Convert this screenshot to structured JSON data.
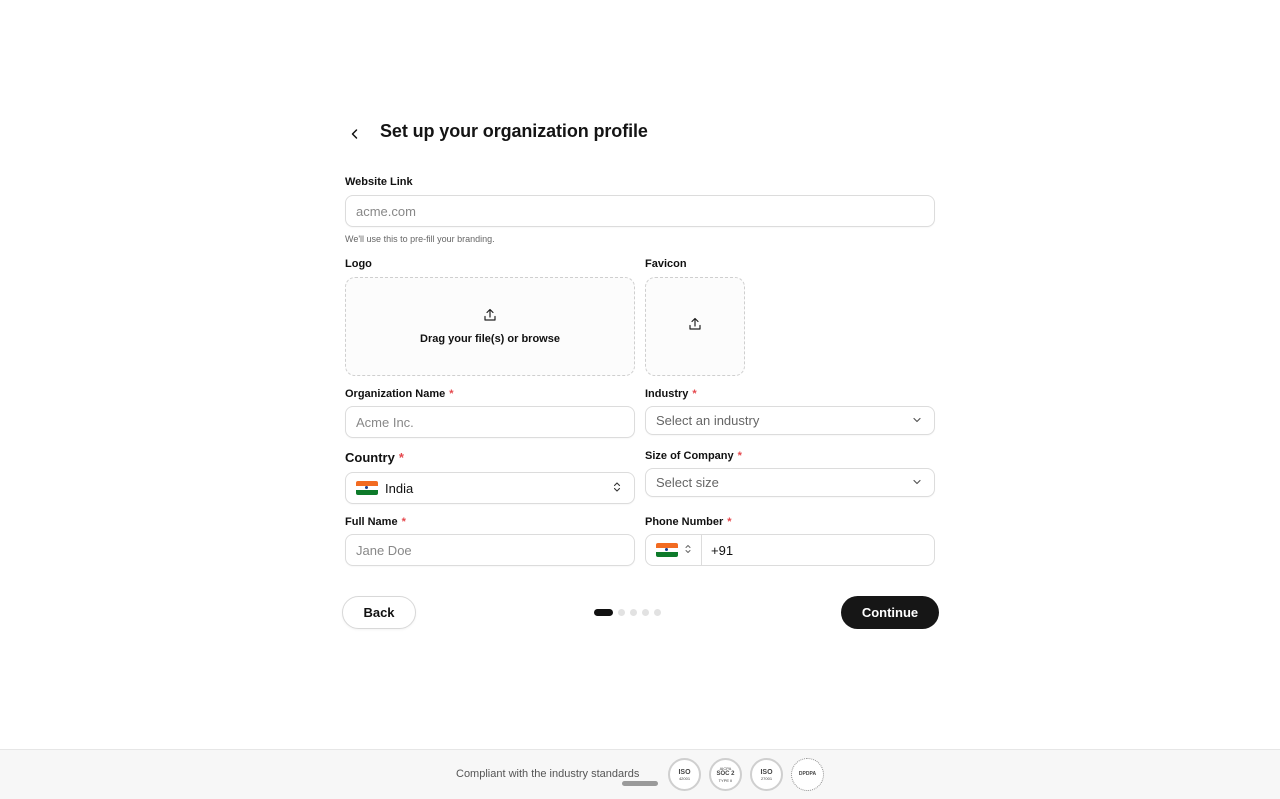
{
  "header": {
    "title": "Set up your organization profile"
  },
  "website": {
    "label": "Website Link",
    "placeholder": "acme.com",
    "hint": "We'll use this to pre-fill your branding."
  },
  "logo": {
    "label": "Logo",
    "dropzone_text": "Drag your file(s) or browse"
  },
  "favicon": {
    "label": "Favicon"
  },
  "org_name": {
    "label": "Organization Name",
    "required": "*",
    "placeholder": "Acme Inc."
  },
  "industry": {
    "label": "Industry",
    "required": "*",
    "placeholder": "Select an industry"
  },
  "country": {
    "label": "Country",
    "required": "*",
    "value": "India"
  },
  "company_size": {
    "label": "Size of Company",
    "required": "*",
    "placeholder": "Select size"
  },
  "full_name": {
    "label": "Full Name",
    "required": "*",
    "placeholder": "Jane Doe"
  },
  "phone": {
    "label": "Phone Number",
    "required": "*",
    "value": "+91"
  },
  "nav": {
    "back_label": "Back",
    "continue_label": "Continue"
  },
  "steps": {
    "total": 5,
    "current": 1
  },
  "footer": {
    "text": "Compliant with the industry standards",
    "badges": [
      {
        "line1": "ISO",
        "line2": "42001"
      },
      {
        "line1": "SOC 2",
        "line2": "TYPE II",
        "top": "AICPA"
      },
      {
        "line1": "ISO",
        "line2": "27001"
      },
      {
        "line1": "DPDPA",
        "line2": ""
      }
    ]
  },
  "colors": {
    "accent": "#161616",
    "required": "#e5484d",
    "border": "#dcdcdc"
  }
}
